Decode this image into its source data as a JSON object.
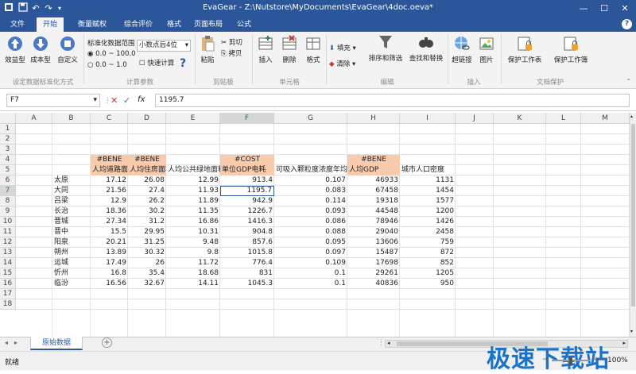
{
  "titlebar": {
    "app": "EvaGear",
    "path": "Z:\\Nutstore\\MyDocuments\\EvaGear\\4doc.oeva*",
    "separator": "-"
  },
  "menu": {
    "tabs": [
      "文件",
      "开始",
      "衡量赋权",
      "综合评价",
      "格式",
      "页面布局",
      "公式"
    ],
    "active": "开始",
    "help": "?"
  },
  "ribbon": {
    "effect_type": "效益型",
    "cost_type": "成本型",
    "custom": "自定义",
    "group_standardize": "设定数据标准化方式",
    "range_title": "标准化数据范围",
    "range_opt1": "0.0 ~ 100.0",
    "range_opt2": "0.0 ~ 1.0",
    "decimal_select": "小数点后4位",
    "fast_calc": "快速计算",
    "group_params": "计算参数",
    "paste": "粘贴",
    "cut": "剪切",
    "copy": "拷贝",
    "group_clipboard": "剪贴板",
    "insert": "插入",
    "delete": "删除",
    "format": "格式",
    "group_cells": "单元格",
    "fill": "填充",
    "clear": "清除",
    "sort_filter": "排序和筛选",
    "find_replace": "查找和替换",
    "group_edit": "编辑",
    "hyperlink": "超链接",
    "picture": "图片",
    "group_insert": "插入",
    "protect_workbook": "保护工作表",
    "protect_workbook2": "保护工作簿",
    "group_protect": "文档保护"
  },
  "formula_bar": {
    "cell_ref": "F7",
    "value": "1195.7",
    "fx": "fx"
  },
  "grid": {
    "columns": [
      "A",
      "B",
      "C",
      "D",
      "E",
      "F",
      "G",
      "H",
      "I",
      "J",
      "K",
      "L",
      "M"
    ],
    "rows": [
      "1",
      "2",
      "3",
      "4",
      "5",
      "6",
      "7",
      "8",
      "9",
      "10",
      "11",
      "12",
      "13",
      "14",
      "15",
      "16",
      "17",
      "18"
    ],
    "selected_col": "F",
    "selected_row": "7",
    "tags": {
      "C": "#BENE",
      "D": "#BENE",
      "F": "#COST",
      "H": "#BENE"
    },
    "headers": {
      "C": "人均道路面积",
      "D": "人均住房面积",
      "E": "人均公共绿地面积",
      "F": "单位GDP电耗",
      "G": "可吸入颗粒度浓度年均值",
      "H": "人均GDP",
      "I": "城市人口密度"
    },
    "data": [
      [
        "太原",
        "17.12",
        "26.08",
        "12.99",
        "913.4",
        "0.107",
        "46933",
        "1131"
      ],
      [
        "大同",
        "21.56",
        "27.4",
        "11.93",
        "1195.7",
        "0.083",
        "67458",
        "1454"
      ],
      [
        "吕梁",
        "12.9",
        "26.2",
        "11.89",
        "942.9",
        "0.114",
        "19318",
        "1577"
      ],
      [
        "长治",
        "18.36",
        "30.2",
        "11.35",
        "1226.7",
        "0.093",
        "44548",
        "1200"
      ],
      [
        "晋城",
        "27.34",
        "31.2",
        "16.86",
        "1416.3",
        "0.086",
        "78946",
        "1426"
      ],
      [
        "晋中",
        "15.5",
        "29.95",
        "10.31",
        "904.8",
        "0.088",
        "29040",
        "2458"
      ],
      [
        "阳泉",
        "20.21",
        "31.25",
        "9.48",
        "857.6",
        "0.095",
        "13606",
        "759"
      ],
      [
        "朔州",
        "13.89",
        "30.32",
        "9.8",
        "1015.8",
        "0.097",
        "15487",
        "872"
      ],
      [
        "运城",
        "17.49",
        "26",
        "11.72",
        "776.4",
        "0.109",
        "17698",
        "852"
      ],
      [
        "忻州",
        "16.8",
        "35.4",
        "18.68",
        "831",
        "0.1",
        "29261",
        "1205"
      ],
      [
        "临汾",
        "16.56",
        "32.67",
        "14.11",
        "1045.3",
        "0.1",
        "40836",
        "950"
      ]
    ]
  },
  "sheet_tab": "原始数据",
  "status": {
    "ready": "就绪",
    "zoom": "100%",
    "watermark": "极速下载站"
  },
  "colors": {
    "accent": "#2b579a",
    "tag_fill": "#f8cbad",
    "selected_header": "#d6d6d6"
  }
}
